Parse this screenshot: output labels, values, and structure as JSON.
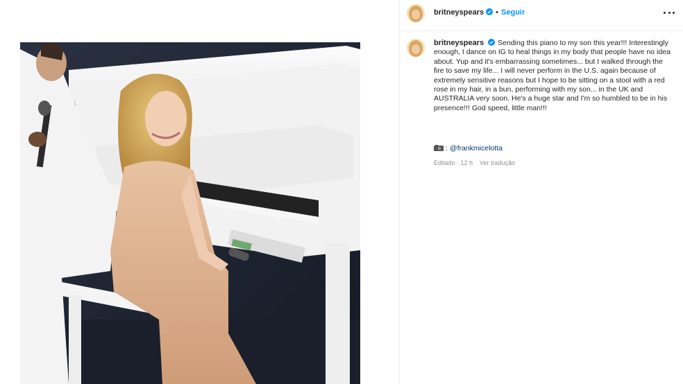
{
  "post": {
    "username": "britneyspears",
    "separator": "•",
    "follow_label": "Seguir",
    "more_icon": "more-horizontal-icon",
    "verified_icon": "verified-badge-icon",
    "verified_color": "#0095f6"
  },
  "caption": {
    "username": "britneyspears",
    "text": "Sending this piano to my son this year!!! Interestingly enough, I dance on IG to heal things in my body that people have no idea about. Yup and it's embarrassing sometimes... but I walked through the fire to save my life... I will never perform in the U.S. again because of extremely sensitive reasons but I hope to be sitting on a stool with a red rose in my hair, in a bun, performing with my son... in the UK and AUSTRALIA very soon. He's a huge star and I'm so humbled to be in his presence!!! God speed, little man!!!",
    "credit_icon": "camera-emoji-icon",
    "credit_colon": ":",
    "credit_mention": "@frankmicelotta"
  },
  "meta": {
    "edited": "Editado · 12 h",
    "see_translation": "Ver tradução"
  },
  "colors": {
    "link": "#00376b",
    "accent": "#0095f6",
    "muted": "#8e8e8e"
  }
}
